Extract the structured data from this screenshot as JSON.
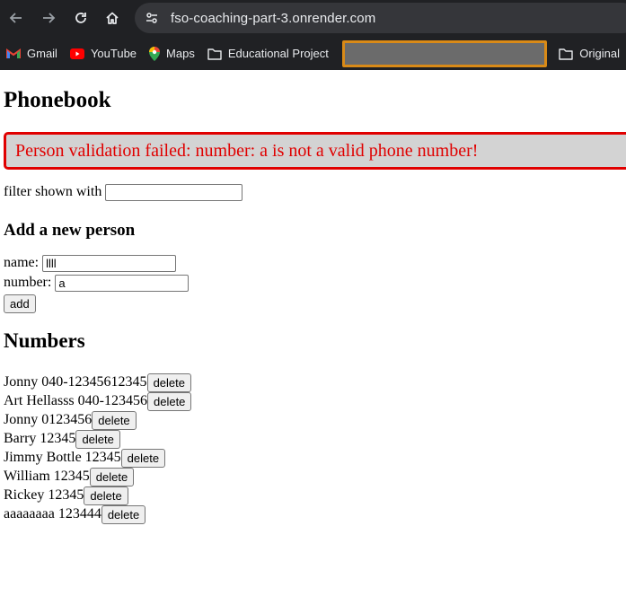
{
  "browser": {
    "url": "fso-coaching-part-3.onrender.com",
    "bookmarks": [
      {
        "label": "Gmail",
        "icon": "gmail-icon"
      },
      {
        "label": "YouTube",
        "icon": "youtube-icon"
      },
      {
        "label": "Maps",
        "icon": "maps-icon"
      },
      {
        "label": "Educational Project",
        "icon": "folder-icon"
      },
      {
        "label": "Original",
        "icon": "folder-icon"
      }
    ],
    "colors": {
      "chrome_bg": "#202124",
      "redaction_border": "#d98a17"
    }
  },
  "page": {
    "title": "Phonebook",
    "error_message": "Person validation failed: number: a is not a valid phone number!",
    "filter_label": "filter shown with",
    "filter_value": "",
    "add_title": "Add a new person",
    "name_label": "name:",
    "name_value": "llll",
    "number_label": "number:",
    "number_value": "a",
    "add_button": "add",
    "numbers_title": "Numbers",
    "delete_label": "delete",
    "persons": [
      {
        "text": "Jonny 040-12345612345"
      },
      {
        "text": "Art Hellasss 040-123456"
      },
      {
        "text": "Jonny 0123456"
      },
      {
        "text": "Barry 12345"
      },
      {
        "text": "Jimmy Bottle 12345"
      },
      {
        "text": "William 12345"
      },
      {
        "text": "Rickey 12345"
      },
      {
        "text": "aaaaaaaa 123444"
      }
    ],
    "colors": {
      "error_text": "#e00000",
      "error_bg": "#d3d3d3"
    }
  }
}
